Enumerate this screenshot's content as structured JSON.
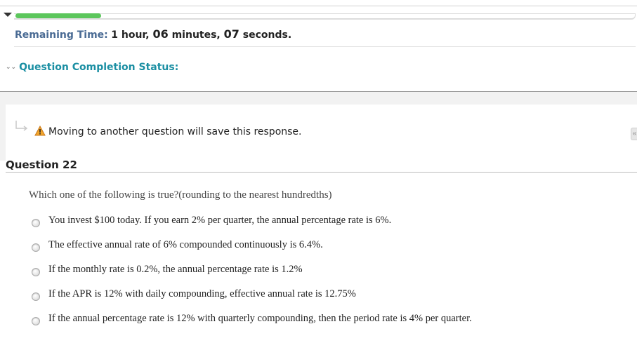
{
  "timer": {
    "label": "Remaining Time:",
    "hours_num": "1",
    "hours_unit": " hour, ",
    "minutes_num": "06",
    "minutes_unit": " minutes, ",
    "seconds_num": "07",
    "seconds_unit": " seconds.",
    "progress_fraction": 0.14,
    "progress_color": "#5cc65c"
  },
  "completion_status": {
    "label": "Question Completion Status:",
    "color": "#1b8fa3"
  },
  "notice": {
    "text": "Moving to another question will save this response.",
    "warning_icon": "warning-triangle-icon",
    "arrow_icon": "arrow-return-icon"
  },
  "question": {
    "title": "Question 22",
    "prompt": "Which one of the following is true?(rounding to the nearest hundredths)",
    "options": [
      "You invest $100 today. If you earn 2% per quarter, the annual percentage rate is 6%.",
      "The effective annual rate of 6% compounded continuously is 6.4%.",
      "If the monthly rate is 0.2%, the annual percentage rate is 1.2%",
      "If the APR is 12% with daily compounding, effective annual rate is 12.75%",
      "If the annual percentage rate is 12% with quarterly compounding, then the period rate is 4% per quarter."
    ]
  },
  "side_panel": {
    "collapse_glyph": "«"
  }
}
